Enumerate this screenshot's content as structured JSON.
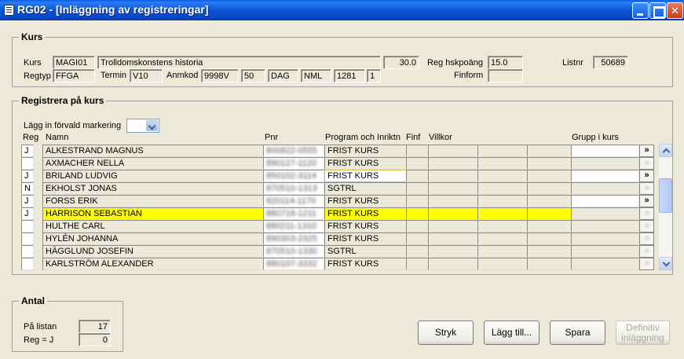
{
  "window": {
    "title": "RG02 - [Inläggning av registreringar]"
  },
  "kurs": {
    "group_title": "Kurs",
    "kurs_label": "Kurs",
    "kurs_code": "MAGI01",
    "kurs_name": "Trolldomskonstens historia",
    "credits": "30.0",
    "reg_hskpoang_label": "Reg hskpoäng",
    "reg_hskpoang": "15.0",
    "listnr_label": "Listnr",
    "listnr": "50689",
    "regtyp_label": "Regtyp",
    "regtyp": "FFGA",
    "termin_label": "Termin",
    "termin": "V10",
    "anmkod_label": "Anmkod",
    "anmkod": "9998V",
    "f1": "50",
    "f2": "DAG",
    "f3": "NML",
    "f4": "1281",
    "f5": "1",
    "finform_label": "Finform",
    "finform": ""
  },
  "registrera": {
    "group_title": "Registrera på kurs",
    "default_mark_label": "Lägg in förvald markering",
    "default_mark_value": "",
    "columns": {
      "reg": "Reg",
      "namn": "Namn",
      "pnr": "Pnr",
      "program": "Program och Inriktn",
      "finf": "Finf",
      "villkor": "Villkor",
      "grupp": "Grupp i kurs"
    },
    "rows": [
      {
        "reg": "J",
        "namn": "ALKESTRAND MAGNUS",
        "pnr": "800822-0555",
        "program": "FRIST KURS",
        "active": true
      },
      {
        "reg": "",
        "namn": "AXMACHER NELLA",
        "pnr": "890127-1120",
        "program": "FRIST KURS",
        "active": false
      },
      {
        "reg": "J",
        "namn": "BRILAND LUDVIG",
        "pnr": "850102-3114",
        "program": "FRIST KURS",
        "active": true
      },
      {
        "reg": "N",
        "namn": "EKHOLST JONAS",
        "pnr": "870510-1313",
        "program": "SGTRL",
        "active": false
      },
      {
        "reg": "J",
        "namn": "FORSS ERIK",
        "pnr": "820114-1170",
        "program": "FRIST KURS",
        "active": true
      },
      {
        "reg": "J",
        "namn": "HARRISON SEBASTIAN",
        "pnr": "880718-1211",
        "program": "FRIST KURS",
        "active": false
      },
      {
        "reg": "",
        "namn": "HULTHE CARL",
        "pnr": "880211-1310",
        "program": "FRIST KURS",
        "active": false
      },
      {
        "reg": "",
        "namn": "HYLÉN JOHANNA",
        "pnr": "890303-2325",
        "program": "FRIST KURS",
        "active": false
      },
      {
        "reg": "",
        "namn": "HÄGGLUND JOSEFIN",
        "pnr": "870510-1330",
        "program": "SGTRL",
        "active": false
      },
      {
        "reg": "",
        "namn": "KARLSTRÖM ALEXANDER",
        "pnr": "880107-3332",
        "program": "FRIST KURS",
        "active": false
      }
    ],
    "arrow_glyph": "»"
  },
  "antal": {
    "group_title": "Antal",
    "pa_listan_label": "På listan",
    "pa_listan": "17",
    "reg_j_label": "Reg = J",
    "reg_j": "0"
  },
  "buttons": {
    "stryk": "Stryk",
    "lagg_till": "Lägg till...",
    "spara": "Spara",
    "definitiv_line1": "Definitiv",
    "definitiv_line2": "inläggning"
  },
  "colors": {
    "highlight": "#ffff00",
    "titlebar": "#0a5ce6"
  }
}
